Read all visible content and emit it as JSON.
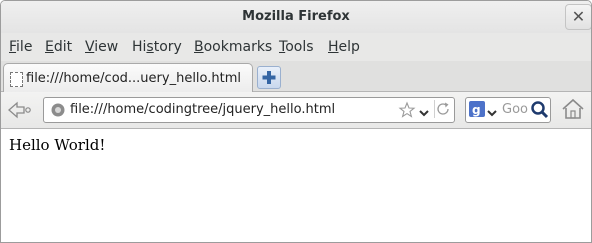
{
  "window": {
    "title": "Mozilla Firefox"
  },
  "menubar": {
    "items": [
      {
        "accel": "F",
        "rest": "ile"
      },
      {
        "accel": "E",
        "rest": "dit"
      },
      {
        "accel": "V",
        "rest": "iew"
      },
      {
        "accel": "",
        "pre": "Hi",
        "accel2": "s",
        "rest": "tory"
      },
      {
        "accel": "B",
        "rest": "ookmarks"
      },
      {
        "accel": "T",
        "rest": "ools"
      },
      {
        "accel": "H",
        "rest": "elp"
      }
    ]
  },
  "tabs": [
    {
      "label": "file:///home/cod...uery_hello.html"
    }
  ],
  "navbar": {
    "url": "file:///home/codingtree/jquery_hello.html",
    "search_placeholder": "Goo"
  },
  "page": {
    "text": "Hello World!"
  },
  "colors": {
    "accent": "#4d72c9",
    "newtab": "#3465a4"
  }
}
